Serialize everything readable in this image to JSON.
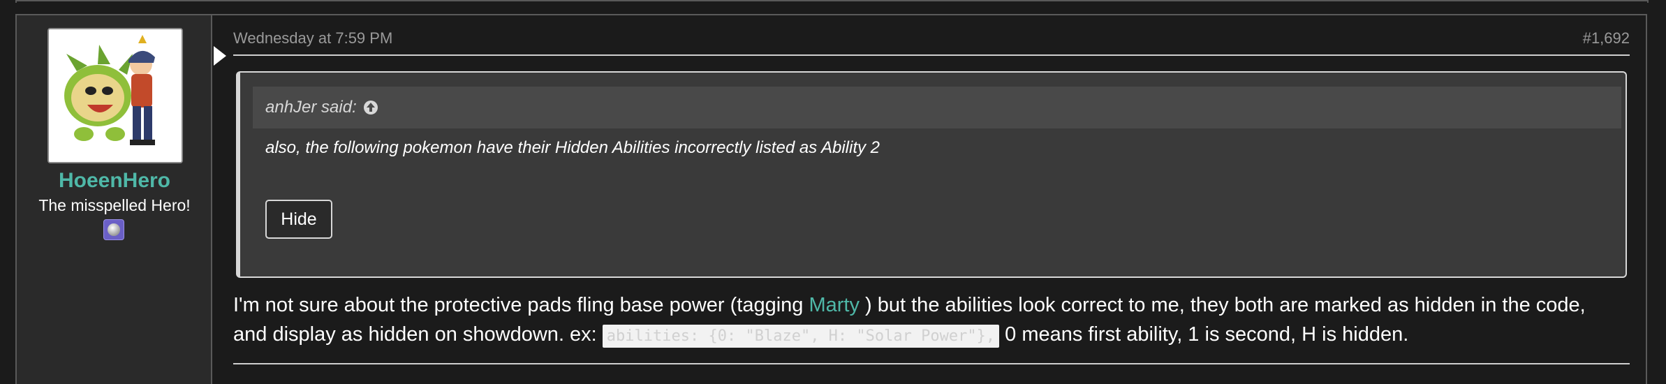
{
  "post": {
    "user": {
      "username": "HoeenHero",
      "user_title": "The misspelled Hero!",
      "avatar_icon": "pokemon-trainer-avatar",
      "badge_icon": "user-badge-icon"
    },
    "meta": {
      "date": "Wednesday at 7:59 PM",
      "post_number": "#1,692"
    },
    "quote": {
      "author_line": "anhJer said:",
      "text": "also, the following pokemon have their Hidden Abilities incorrectly listed as Ability 2",
      "hide_label": "Hide"
    },
    "message": {
      "part1": "I'm not sure about the protective pads fling base power (tagging ",
      "mention": "Marty",
      "part2": " ) but the abilities look correct to me, they both are marked as hidden in the code, and display as hidden on showdown. ex: ",
      "code": "abilities: {0: \"Blaze\", H: \"Solar Power\"},",
      "part3": " 0 means first ability, 1 is second, H is hidden."
    }
  },
  "colors": {
    "accent": "#4fb8a8",
    "background": "#1b1b1b",
    "sidebar": "#2a2a2a",
    "quote_bg": "#3a3a3a"
  }
}
